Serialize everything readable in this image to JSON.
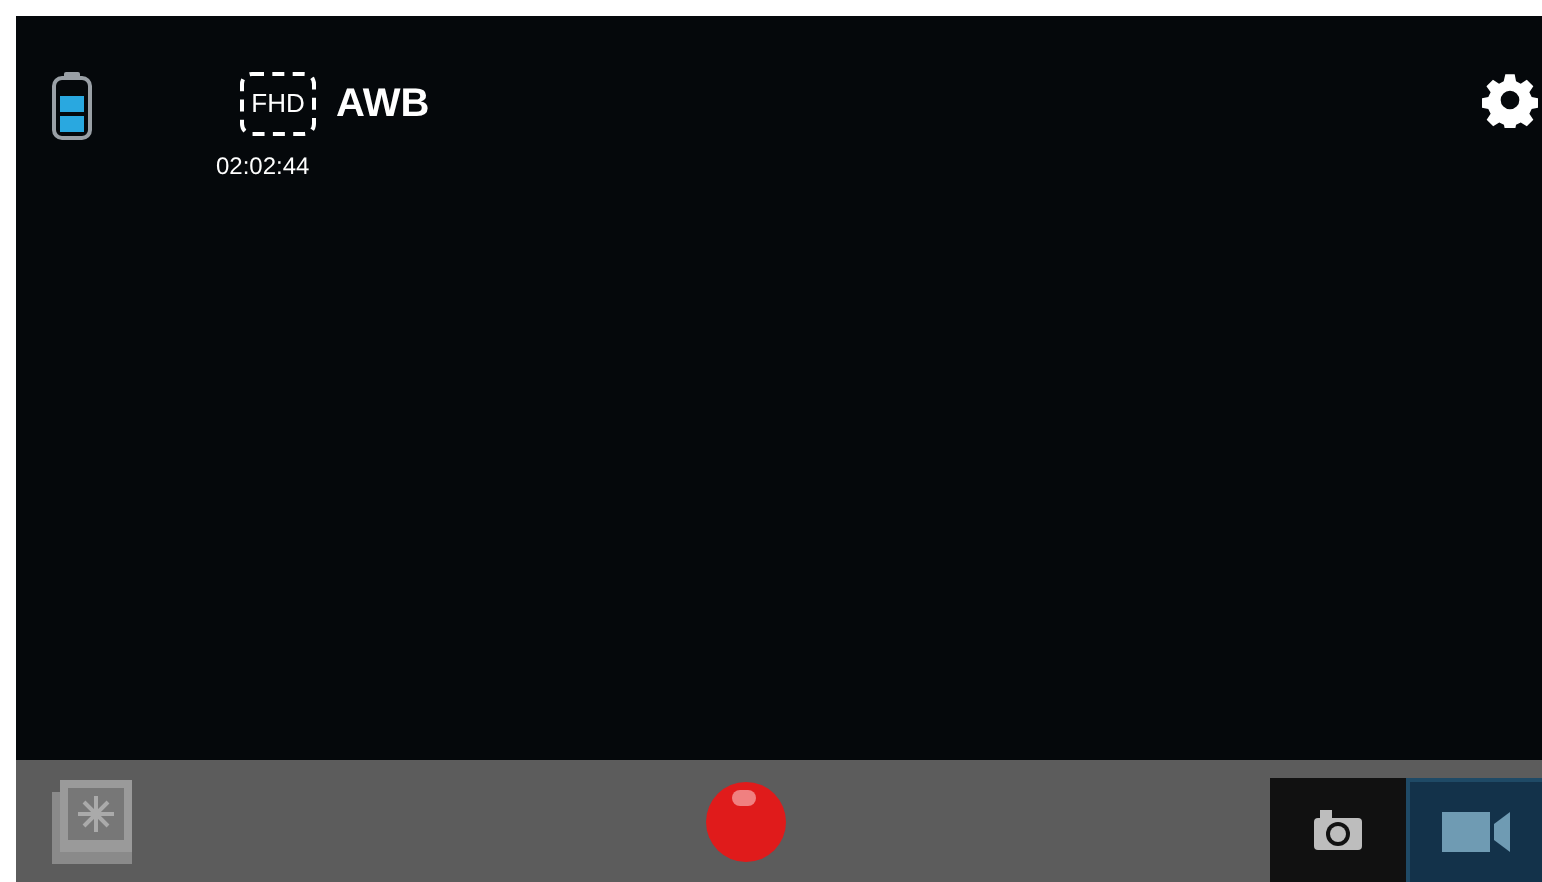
{
  "status": {
    "resolution": "FHD",
    "white_balance": "AWB",
    "recording_time": "02:02:44"
  },
  "modes": [
    {
      "kind": "photo",
      "selected": false
    },
    {
      "kind": "video",
      "selected": true
    }
  ]
}
